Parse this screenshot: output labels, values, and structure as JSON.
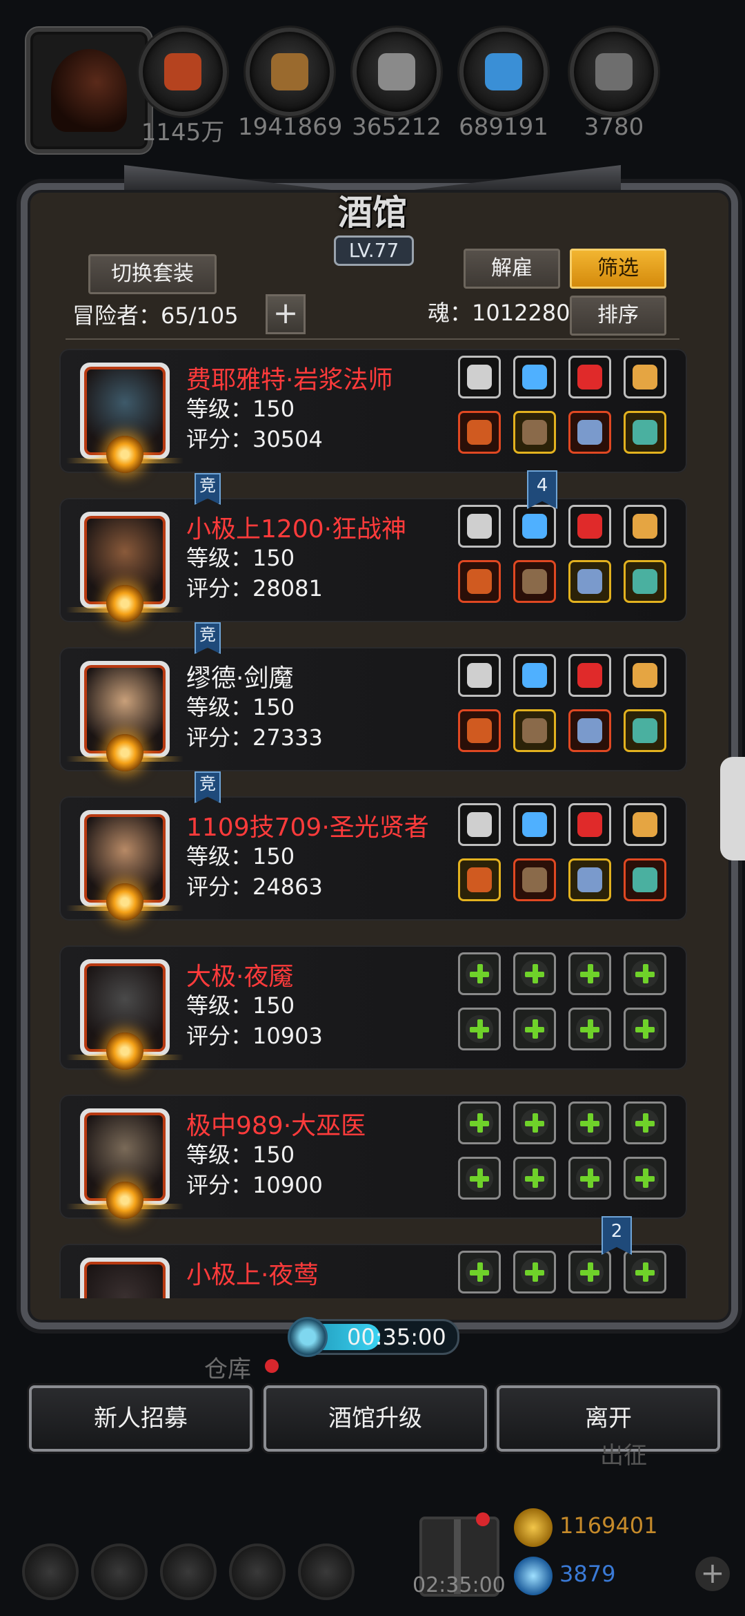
{
  "resources": [
    {
      "icon": "meat-icon",
      "value": "1145万",
      "color": "#b5431f"
    },
    {
      "icon": "wood-icon",
      "value": "1941869",
      "color": "#9a6a2e"
    },
    {
      "icon": "stone-icon",
      "value": "365212",
      "color": "#8a8a8a"
    },
    {
      "icon": "crystal-icon",
      "value": "689191",
      "color": "#3a8fd6"
    },
    {
      "icon": "iron-icon",
      "value": "3780",
      "color": "#6e6e6e"
    }
  ],
  "tavern": {
    "title": "酒馆",
    "level": "LV.77",
    "switch_outfit_label": "切换套装",
    "adventurers_label": "冒险者：65/105",
    "add_label": "+",
    "dismiss_label": "解雇",
    "filter_label": "筛选",
    "soul_label": "魂：1012280",
    "sort_label": "排序"
  },
  "heroes": [
    {
      "name": "费耶雅特·岩浆法师",
      "name_color": "red",
      "level": "等级：150",
      "score": "评分：30504",
      "face": "#3e5a6a",
      "slots": [
        "silver",
        "silver",
        "silver",
        "silver",
        "red",
        "gold",
        "red",
        "gold"
      ]
    },
    {
      "name": "小极上1200·狂战神",
      "name_color": "red",
      "level": "等级：150",
      "score": "评分：28081",
      "face": "#8a5a3a",
      "slots": [
        "silver",
        "silver",
        "silver",
        "silver",
        "red",
        "red",
        "gold",
        "gold"
      ]
    },
    {
      "name": "缪德·剑魔",
      "name_color": "white",
      "level": "等级：150",
      "score": "评分：27333",
      "face": "#c9a07a",
      "slots": [
        "silver",
        "silver",
        "silver",
        "silver",
        "red",
        "gold",
        "red",
        "gold"
      ]
    },
    {
      "name": "1109技709·圣光贤者",
      "name_color": "red",
      "level": "等级：150",
      "score": "评分：24863",
      "face": "#b88a66",
      "slots": [
        "silver",
        "silver",
        "silver",
        "silver",
        "gold",
        "red",
        "gold",
        "red"
      ]
    },
    {
      "name": "大极·夜魇",
      "name_color": "red",
      "level": "等级：150",
      "score": "评分：10903",
      "face": "#4a4a4a",
      "slots": [
        "empty",
        "empty",
        "empty",
        "empty",
        "empty",
        "empty",
        "empty",
        "empty"
      ]
    },
    {
      "name": "极中989·大巫医",
      "name_color": "red",
      "level": "等级：150",
      "score": "评分：10900",
      "face": "#7a6a58",
      "slots": [
        "empty",
        "empty",
        "empty",
        "empty",
        "empty",
        "empty",
        "empty",
        "empty"
      ]
    },
    {
      "name": "小极上·夜莺",
      "name_color": "red",
      "level": "",
      "score": "",
      "face": "#3a3030",
      "slots": [
        "empty",
        "empty",
        "empty",
        "empty"
      ]
    }
  ],
  "tags": {
    "compete": "竞",
    "badge1": "4",
    "badge2": "2"
  },
  "timer": {
    "value": "00:35:00",
    "progress": 0.55
  },
  "bottom": {
    "warehouse": "仓库",
    "recruit_label": "新人招募",
    "upgrade_label": "酒馆升级",
    "leave_label": "离开",
    "expedition": "出征",
    "gift_timer": "02:35:00",
    "gold": "1169401",
    "diamond": "3879"
  }
}
